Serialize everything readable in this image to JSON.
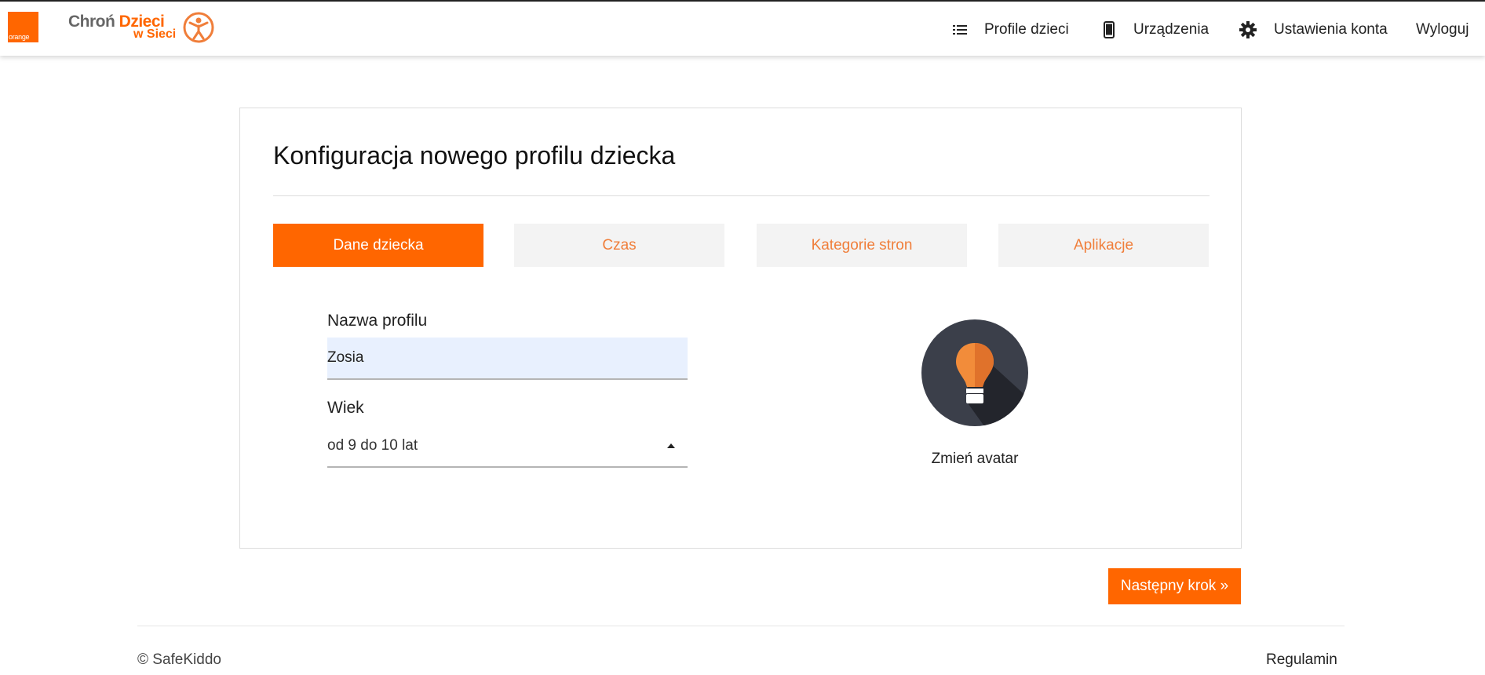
{
  "header": {
    "operator_logo_text": "orange",
    "brand_line1_a": "Chroń",
    "brand_line1_b": "Dzieci",
    "brand_line2": "w Sieci",
    "nav": {
      "profiles": "Profile dzieci",
      "devices": "Urządzenia",
      "settings": "Ustawienia konta",
      "logout": "Wyloguj"
    }
  },
  "card": {
    "title": "Konfiguracja nowego profilu dziecka",
    "tabs": [
      "Dane dziecka",
      "Czas",
      "Kategorie stron",
      "Aplikacje"
    ],
    "active_tab": "Dane dziecka",
    "profile_name_label": "Nazwa profilu",
    "profile_name_value": "Zosia",
    "age_label": "Wiek",
    "age_value": "od 9 do 10 lat",
    "avatar_icon": "lightbulb-icon",
    "change_avatar_label": "Zmień avatar"
  },
  "actions": {
    "next_step": "Następny krok »"
  },
  "footer": {
    "copyright": "© SafeKiddo",
    "terms": "Regulamin"
  },
  "colors": {
    "accent": "#ff6600",
    "tab_inactive_bg": "#f3f3f3",
    "tab_inactive_text": "#f07e3a",
    "input_fill": "#e8f0fe",
    "avatar_bg": "#3b3f4a"
  }
}
